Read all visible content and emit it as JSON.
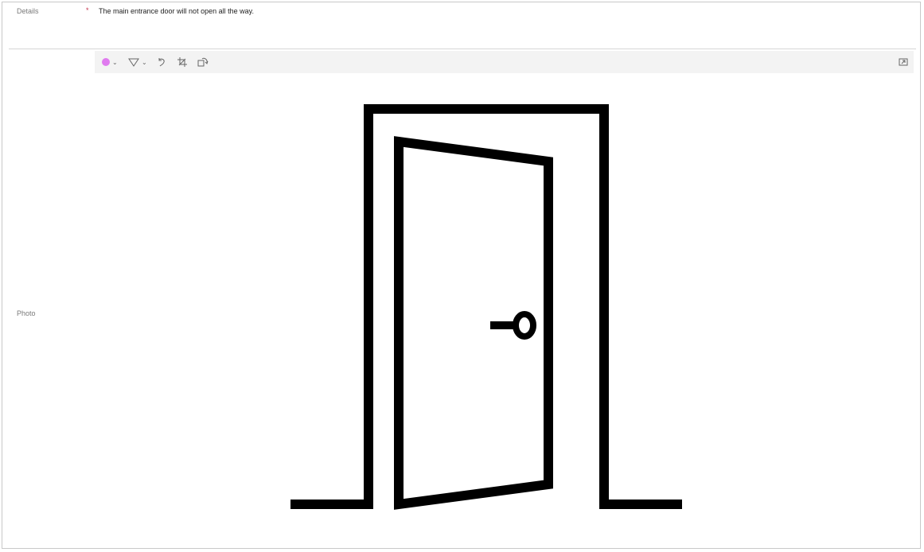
{
  "form": {
    "details": {
      "label": "Details",
      "required_mark": "*",
      "value": "The main entrance door will not open all the way."
    },
    "photo": {
      "label": "Photo"
    }
  },
  "toolbar": {
    "pen_color": "#e07bef",
    "items": [
      {
        "name": "pen-color",
        "icon": "color-dot-icon",
        "dropdown": true
      },
      {
        "name": "eraser",
        "icon": "eraser-icon",
        "dropdown": true
      },
      {
        "name": "undo",
        "icon": "undo-icon"
      },
      {
        "name": "crop",
        "icon": "crop-icon"
      },
      {
        "name": "rotate",
        "icon": "rotate-icon"
      },
      {
        "name": "expand",
        "icon": "expand-icon"
      }
    ]
  },
  "image": {
    "subject": "door-icon",
    "stroke_color": "#000000"
  }
}
